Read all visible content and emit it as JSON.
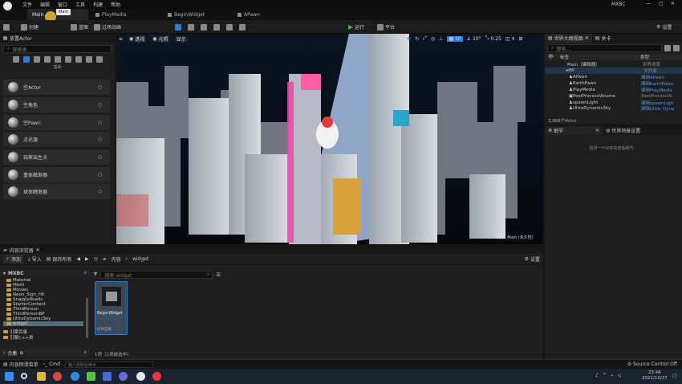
{
  "titlebar": {
    "menus": [
      "文件",
      "编辑",
      "窗口",
      "工具",
      "构建",
      "帮助"
    ],
    "project": "MXBC"
  },
  "tabs": [
    {
      "label": "Main",
      "tooltip": "Main"
    },
    {
      "label": "PlayMedia"
    },
    {
      "label": "BeginWidget"
    },
    {
      "label": "APawn"
    }
  ],
  "toolbar": {
    "save": "",
    "create": "创建",
    "blueprint": "",
    "play_anim": "蓝图",
    "transition": "过场动画",
    "run": "运行",
    "platform": "平台",
    "settings": "设置"
  },
  "left": {
    "panel_title": "放置Actor",
    "search_placeholder": "搜索类",
    "category_label": "基础",
    "items": [
      "空Actor",
      "空角色",
      "空Pawn",
      "点光源",
      "玩家出生点",
      "盒体触发器",
      "球体触发器"
    ]
  },
  "viewport": {
    "perspective": "透视",
    "lit": "光照",
    "show": "显示",
    "grid": "10",
    "rot": "10°",
    "scale": "0.25",
    "cam": "4",
    "overlay": "关卡: Main (永久性)"
  },
  "outliner": {
    "title": "世界大纲视图",
    "close_label": "关卡",
    "search_placeholder": "搜索...",
    "col_label": "标签",
    "col_type": "类型",
    "rows": [
      {
        "name": "Main（编辑器）",
        "type": "世界场景"
      },
      {
        "name": "BP",
        "type": "文件夹"
      },
      {
        "name": "APawn",
        "type": "编辑APawn"
      },
      {
        "name": "EarthPawn",
        "type": "编辑EarthPawn"
      },
      {
        "name": "PlayMedia",
        "type": "编辑PlayMedia"
      },
      {
        "name": "PostProcessVolume",
        "type": "PostProcessVo"
      },
      {
        "name": "spawnLight",
        "type": "编辑spawnLigh"
      },
      {
        "name": "UltraDynamicSky",
        "type": "编辑Ultra_Dyna"
      }
    ],
    "count": "3,868个Actor"
  },
  "details": {
    "title": "细节",
    "world_settings": "世界场景设置",
    "empty_hint": "选择一个对象来查看细节。"
  },
  "content": {
    "title": "内容浏览器",
    "add": "添加",
    "import": "导入",
    "save_all": "保存所有",
    "path_root": "内容",
    "path_leaf": "widget",
    "settings": "设置",
    "root": "MXBC",
    "search_placeholder": "搜索 widget",
    "folders": [
      "Material",
      "Mesh",
      "Movies",
      "Neon_Sign_HK",
      "SnappyRoads",
      "StarterContent",
      "ThirdPerson",
      "ThirdPersonBP",
      "UltraDynamicSky",
      "widget"
    ],
    "engine_folders": [
      "引擎目录",
      "引擎C++类"
    ],
    "collections": "合集",
    "asset_name": "BeginWidget",
    "asset_type": "控件蓝图",
    "status": "1项（1项被选中）"
  },
  "statusbar": {
    "drawer": "内容侧滑菜单",
    "cmd": "Cmd",
    "console_placeholder": "输入控制台命令",
    "source_control": "Source Control Off"
  },
  "taskbar": {
    "time": "23:46",
    "date": "2021/10/27"
  },
  "colors": {
    "accent": "#2a7dd6",
    "run": "#4caf50"
  }
}
